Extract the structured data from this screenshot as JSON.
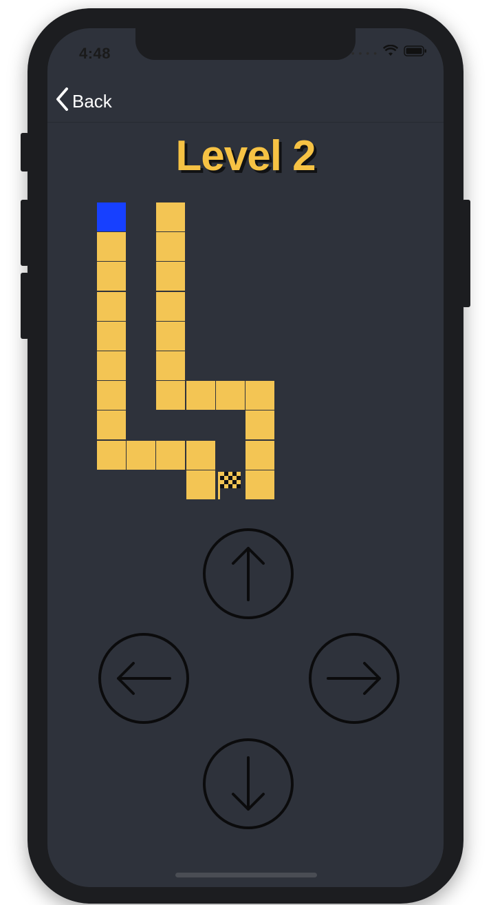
{
  "status_bar": {
    "time": "4:48",
    "signal_icon": "signal-dots-icon",
    "wifi_icon": "wifi-icon",
    "battery_icon": "battery-icon"
  },
  "nav": {
    "back_label": "Back",
    "back_icon": "chevron-left-icon"
  },
  "game": {
    "title": "Level 2",
    "grid": {
      "columns": 6,
      "rows": 10,
      "path_cells": [
        [
          0,
          0
        ],
        [
          0,
          1
        ],
        [
          0,
          2
        ],
        [
          0,
          3
        ],
        [
          0,
          4
        ],
        [
          0,
          5
        ],
        [
          0,
          6
        ],
        [
          0,
          7
        ],
        [
          0,
          8
        ],
        [
          1,
          8
        ],
        [
          2,
          8
        ],
        [
          3,
          8
        ],
        [
          3,
          9
        ],
        [
          2,
          0
        ],
        [
          2,
          1
        ],
        [
          2,
          2
        ],
        [
          2,
          3
        ],
        [
          2,
          4
        ],
        [
          2,
          5
        ],
        [
          2,
          6
        ],
        [
          3,
          6
        ],
        [
          4,
          6
        ],
        [
          5,
          6
        ],
        [
          5,
          7
        ],
        [
          5,
          8
        ],
        [
          5,
          9
        ]
      ],
      "player_cell": [
        0,
        0
      ],
      "finish_cell": [
        4,
        9
      ]
    },
    "colors": {
      "path": "#f3c554",
      "player": "#1740ff",
      "background": "#2e323b",
      "title": "#f6c244"
    }
  },
  "controls": {
    "up_icon": "arrow-up-icon",
    "left_icon": "arrow-left-icon",
    "right_icon": "arrow-right-icon",
    "down_icon": "arrow-down-icon"
  }
}
